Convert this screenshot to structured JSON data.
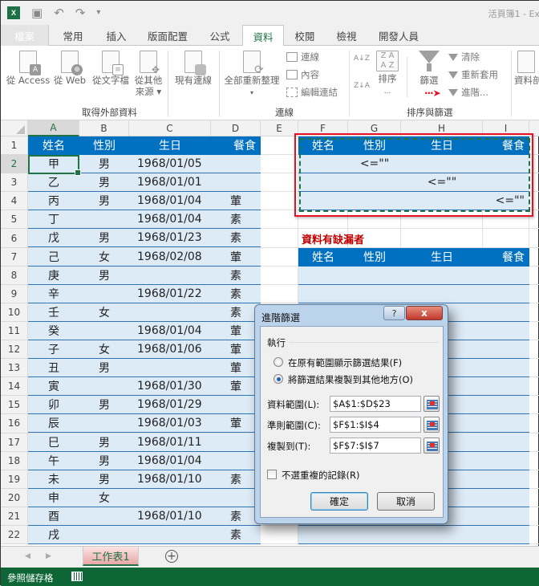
{
  "window": {
    "title": "活頁簿1 - Ex"
  },
  "qat": {
    "logo": "X",
    "save_icon": "💾",
    "undo_icon": "↶",
    "redo_icon": "↷",
    "more_icon": "▾"
  },
  "tabs": [
    "檔案",
    "常用",
    "插入",
    "版面配置",
    "公式",
    "資料",
    "校閱",
    "檢視",
    "開發人員"
  ],
  "active_tab": "資料",
  "ribbon": {
    "get_external": {
      "label": "取得外部資料",
      "buttons": [
        "從 Access",
        "從 Web",
        "從文字檔",
        "從其他",
        "來源 ▾"
      ]
    },
    "existing_connections": "現有連線",
    "connections": {
      "label": "連線",
      "refresh_all": "全部重新整理",
      "refresh_arrow": "▾",
      "items": [
        "連線",
        "內容",
        "編輯連結"
      ]
    },
    "sort_filter": {
      "label": "排序與篩選",
      "sort_az": "A↓Z",
      "sort_za": "Z↓A",
      "sort": "排序",
      "sort_more": "...",
      "filter": "篩選",
      "clear": "清除",
      "reapply": "重新套用",
      "advanced": "進階..."
    },
    "data_tools": "資料剖"
  },
  "annotation": {
    "arrow": "···➤"
  },
  "sheet": {
    "columns": [
      "A",
      "B",
      "C",
      "D",
      "E",
      "F",
      "G",
      "H",
      "I"
    ],
    "rows": [
      "1",
      "2",
      "3",
      "4",
      "5",
      "6",
      "7",
      "8",
      "9",
      "10",
      "11",
      "12",
      "13",
      "14",
      "15",
      "16",
      "17",
      "18",
      "19",
      "20",
      "21",
      "22"
    ],
    "header": [
      "姓名",
      "性別",
      "生日",
      "餐食"
    ],
    "data": [
      [
        "甲",
        "男",
        "1968/01/05",
        ""
      ],
      [
        "乙",
        "男",
        "1968/01/01",
        ""
      ],
      [
        "丙",
        "男",
        "1968/01/04",
        "葷"
      ],
      [
        "丁",
        "",
        "1968/01/04",
        "素"
      ],
      [
        "戊",
        "男",
        "1968/01/23",
        "素"
      ],
      [
        "己",
        "女",
        "1968/02/08",
        "葷"
      ],
      [
        "庚",
        "男",
        "",
        "素"
      ],
      [
        "辛",
        "",
        "1968/01/22",
        "素"
      ],
      [
        "壬",
        "女",
        "",
        "素"
      ],
      [
        "癸",
        "",
        "1968/01/04",
        "葷"
      ],
      [
        "子",
        "女",
        "1968/01/06",
        "葷"
      ],
      [
        "丑",
        "男",
        "",
        "葷"
      ],
      [
        "寅",
        "",
        "1968/01/30",
        "葷"
      ],
      [
        "卯",
        "男",
        "1968/01/29",
        ""
      ],
      [
        "辰",
        "",
        "1968/01/03",
        "葷"
      ],
      [
        "巳",
        "男",
        "1968/01/11",
        ""
      ],
      [
        "午",
        "男",
        "1968/01/04",
        ""
      ],
      [
        "未",
        "男",
        "1968/01/10",
        "素"
      ],
      [
        "申",
        "女",
        "",
        ""
      ],
      [
        "酉",
        "",
        "1968/01/10",
        "素"
      ],
      [
        "戌",
        "",
        "",
        "素"
      ]
    ],
    "criteria_header": [
      "姓名",
      "性別",
      "生日",
      "餐食"
    ],
    "criteria": [
      [
        "",
        "<=\"\"",
        "",
        ""
      ],
      [
        "",
        "",
        "<=\"\"",
        ""
      ],
      [
        "",
        "",
        "",
        "<=\"\""
      ]
    ],
    "missing_label": "資料有缺漏者",
    "output_header": [
      "姓名",
      "性別",
      "生日",
      "餐食"
    ],
    "sheet_tab": "工作表1",
    "add_sheet": "+"
  },
  "status": {
    "text": "參照儲存格"
  },
  "dialog": {
    "title": "進階篩選",
    "help": "?",
    "close": "x",
    "action_label": "執行",
    "option1": "在原有範圍顯示篩選結果(F)",
    "option2": "將篩選結果複製到其他地方(O)",
    "selected_option": 2,
    "list_range_label": "資料範圍(L):",
    "list_range": "$A$1:$D$23",
    "criteria_range_label": "準則範圍(C):",
    "criteria_range": "$F$1:$I$4",
    "copy_to_label": "複製到(T):",
    "copy_to": "$F$7:$I$7",
    "unique_label": "不選重複的記錄(R)",
    "unique_checked": false,
    "ok": "確定",
    "cancel": "取消"
  }
}
